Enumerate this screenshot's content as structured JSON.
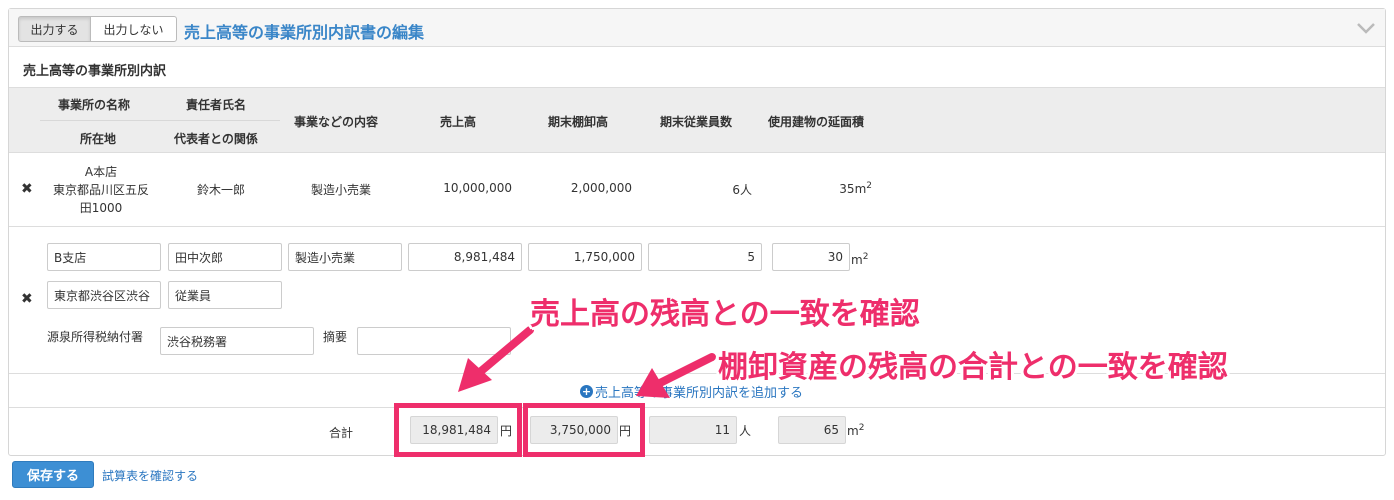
{
  "header": {
    "toggle_on": "出力する",
    "toggle_off": "出力しない",
    "title": "売上高等の事業所別内訳書の編集",
    "collapse_icon": "chevron-down-icon"
  },
  "section_title": "売上高等の事業所別内訳",
  "columns": {
    "office_name": "事業所の名称",
    "location": "所在地",
    "manager": "責任者氏名",
    "relation": "代表者との関係",
    "business": "事業などの内容",
    "sales": "売上高",
    "inventory": "期末棚卸高",
    "employees": "期末従業員数",
    "floor_area": "使用建物の延面積"
  },
  "rows": [
    {
      "name": "A本店",
      "address_line1": "東京都品川区五反",
      "address_line2": "田1000",
      "manager": "鈴木一郎",
      "business": "製造小売業",
      "sales": "10,000,000",
      "inventory": "2,000,000",
      "employees": "6人",
      "area": "35m",
      "area_sup": "2"
    },
    {
      "name": "B支店",
      "manager": "田中次郎",
      "business": "製造小売業",
      "sales": "8,981,484",
      "inventory": "1,750,000",
      "employees": "5",
      "area": "30",
      "area_unit": "m",
      "area_sup": "2",
      "address": "東京都渋谷区渋谷",
      "relation": "従業員",
      "tax_office_label": "源泉所得税納付署",
      "tax_office": "渋谷税務署",
      "memo_label": "摘要",
      "memo": ""
    }
  ],
  "delete_icon": "close-icon",
  "add_link": "売上高等の事業所別内訳を追加する",
  "totals": {
    "label": "合計",
    "sales": "18,981,484",
    "sales_unit": "円",
    "inventory": "3,750,000",
    "inventory_unit": "円",
    "employees": "11",
    "employees_unit": "人",
    "area": "65",
    "area_unit": "m",
    "area_sup": "2"
  },
  "footer": {
    "save": "保存する",
    "check_link": "試算表を確認する"
  },
  "annotations": {
    "callout1": "売上高の残高との一致を確認",
    "callout2": "棚卸資産の残高の合計との一致を確認",
    "color": "#ee2e6b"
  }
}
